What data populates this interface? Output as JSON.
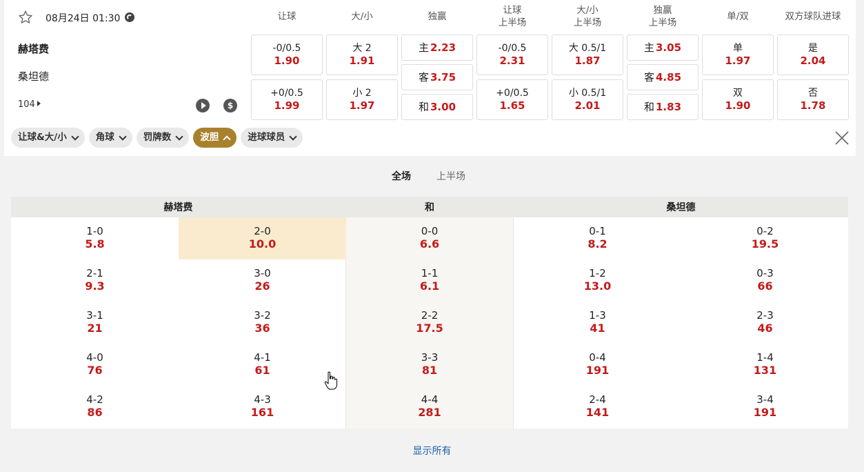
{
  "match": {
    "date": "08月24日 01:30",
    "home": "赫塔费",
    "away": "桑坦德",
    "more_count": "104"
  },
  "columns": [
    "让球",
    "大/小",
    "独赢",
    "让球\n上半场",
    "大/小\n上半场",
    "独赢\n上半场",
    "单/双",
    "双方球队进球"
  ],
  "odds": {
    "hcp": [
      {
        "label": "-0/0.5",
        "value": "1.90"
      },
      {
        "label": "+0/0.5",
        "value": "1.99"
      }
    ],
    "ou": [
      {
        "label": "大 2",
        "value": "1.91"
      },
      {
        "label": "小 2",
        "value": "1.97"
      }
    ],
    "win": [
      {
        "label": "主",
        "value": "2.23"
      },
      {
        "label": "客",
        "value": "3.75"
      },
      {
        "label": "和",
        "value": "3.00"
      }
    ],
    "hcp_1h": [
      {
        "label": "-0/0.5",
        "value": "2.31"
      },
      {
        "label": "+0/0.5",
        "value": "1.65"
      }
    ],
    "ou_1h": [
      {
        "label": "大 0.5/1",
        "value": "1.87"
      },
      {
        "label": "小 0.5/1",
        "value": "2.01"
      }
    ],
    "win_1h": [
      {
        "label": "主",
        "value": "3.05"
      },
      {
        "label": "客",
        "value": "4.85"
      },
      {
        "label": "和",
        "value": "1.83"
      }
    ],
    "oe": [
      {
        "label": "单",
        "value": "1.97"
      },
      {
        "label": "双",
        "value": "1.90"
      }
    ],
    "btts": [
      {
        "label": "是",
        "value": "2.04"
      },
      {
        "label": "否",
        "value": "1.78"
      }
    ]
  },
  "chips": [
    {
      "label": "让球&大/小",
      "active": false
    },
    {
      "label": "角球",
      "active": false
    },
    {
      "label": "罚牌数",
      "active": false
    },
    {
      "label": "波胆",
      "active": true
    },
    {
      "label": "进球球员",
      "active": false
    }
  ],
  "tabs": {
    "full": "全场",
    "half": "上半场"
  },
  "correct_score": {
    "head": {
      "home": "赫塔费",
      "draw": "和",
      "away": "桑坦德"
    },
    "rows": [
      [
        {
          "s": "1-0",
          "o": "5.8"
        },
        {
          "s": "2-0",
          "o": "10.0"
        },
        {
          "s": "0-0",
          "o": "6.6"
        },
        {
          "s": "0-1",
          "o": "8.2"
        },
        {
          "s": "0-2",
          "o": "19.5"
        }
      ],
      [
        {
          "s": "2-1",
          "o": "9.3"
        },
        {
          "s": "3-0",
          "o": "26"
        },
        {
          "s": "1-1",
          "o": "6.1"
        },
        {
          "s": "1-2",
          "o": "13.0"
        },
        {
          "s": "0-3",
          "o": "66"
        }
      ],
      [
        {
          "s": "3-1",
          "o": "21"
        },
        {
          "s": "3-2",
          "o": "36"
        },
        {
          "s": "2-2",
          "o": "17.5"
        },
        {
          "s": "1-3",
          "o": "41"
        },
        {
          "s": "2-3",
          "o": "46"
        }
      ],
      [
        {
          "s": "4-0",
          "o": "76"
        },
        {
          "s": "4-1",
          "o": "61"
        },
        {
          "s": "3-3",
          "o": "81"
        },
        {
          "s": "0-4",
          "o": "191"
        },
        {
          "s": "1-4",
          "o": "131"
        }
      ],
      [
        {
          "s": "4-2",
          "o": "86"
        },
        {
          "s": "4-3",
          "o": "161"
        },
        {
          "s": "4-4",
          "o": "281"
        },
        {
          "s": "2-4",
          "o": "141"
        },
        {
          "s": "3-4",
          "o": "191"
        }
      ]
    ]
  },
  "show_all": "显示所有",
  "colors": {
    "odds_red": "#c41a1a",
    "active_chip": "#a8812d",
    "highlight": "#faebcf",
    "link_blue": "#1a5fb4"
  }
}
